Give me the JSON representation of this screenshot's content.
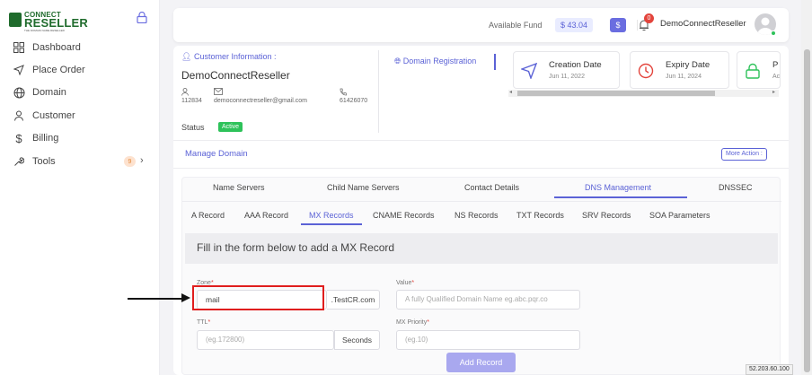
{
  "logo": {
    "line1": "CONNECT",
    "line2": "RESELLER",
    "tagline": "THE DOMAIN NAME RESELLER"
  },
  "sidebar": {
    "items": [
      {
        "label": "Dashboard",
        "icon": "grid-icon"
      },
      {
        "label": "Place Order",
        "icon": "send-icon"
      },
      {
        "label": "Domain",
        "icon": "globe-icon"
      },
      {
        "label": "Customer",
        "icon": "user-icon"
      },
      {
        "label": "Billing",
        "icon": "dollar-icon"
      },
      {
        "label": "Tools",
        "icon": "wrench-icon",
        "badge": "9"
      }
    ]
  },
  "header": {
    "fund_label": "Available Fund",
    "fund_value": "$ 43.04",
    "dollar_button": "$",
    "notification_count": "0",
    "user_name": "DemoConnectReseller"
  },
  "customer": {
    "title": "Customer Information :",
    "name": "DemoConnectReseller",
    "id": "112834",
    "email": "democonnectreseller@gmail.com",
    "phone": "61426070",
    "status_label": "Status",
    "status_value": "Active"
  },
  "domain_registration": "Domain Registration",
  "info_cards": [
    {
      "title": "Creation Date",
      "date": "Jun 11, 2022"
    },
    {
      "title": "Expiry Date",
      "date": "Jun 11, 2024"
    },
    {
      "title": "P",
      "date": "Ac"
    }
  ],
  "manage_domain": "Manage Domain",
  "more_action": "More Action :",
  "tabs": [
    "Name Servers",
    "Child Name Servers",
    "Contact Details",
    "DNS Management",
    "DNSSEC"
  ],
  "active_tab": "DNS Management",
  "subtabs": [
    "A Record",
    "AAA Record",
    "MX Records",
    "CNAME Records",
    "NS Records",
    "TXT Records",
    "SRV Records",
    "SOA Parameters"
  ],
  "active_subtab": "MX Records",
  "form": {
    "heading": "Fill in the form below to add a MX Record",
    "zone_label": "Zone",
    "zone_value": "mail",
    "zone_suffix": ".TestCR.com",
    "value_label": "Value",
    "value_placeholder": "A fully Qualified Domain Name eg.abc.pqr.co",
    "ttl_label": "TTL",
    "ttl_placeholder": "(eg.172800)",
    "ttl_suffix": "Seconds",
    "priority_label": "MX Priority",
    "priority_placeholder": "(eg.10)",
    "submit": "Add Record",
    "required_mark": "*"
  },
  "ip_tag": "52.203.60.100",
  "colors": {
    "accent": "#5b62d6",
    "brand": "#1f6b2c",
    "active": "#2ec25a",
    "highlight": "#e01e1e"
  }
}
